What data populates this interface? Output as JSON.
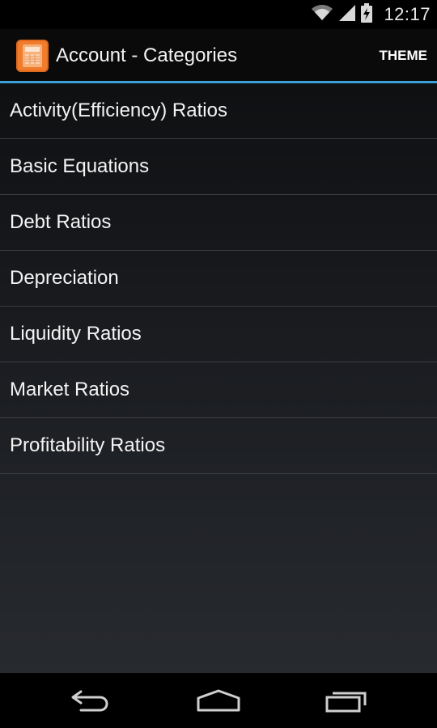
{
  "status_bar": {
    "time": "12:17",
    "icons": [
      "wifi-icon",
      "signal-icon",
      "battery-charging-icon"
    ]
  },
  "action_bar": {
    "title": "Account - Categories",
    "theme_label": "THEME",
    "app_icon": "calculator-icon",
    "accent_color": "#3aa0d8"
  },
  "categories": [
    {
      "label": "Activity(Efficiency) Ratios"
    },
    {
      "label": "Basic Equations"
    },
    {
      "label": "Debt Ratios"
    },
    {
      "label": "Depreciation"
    },
    {
      "label": "Liquidity Ratios"
    },
    {
      "label": "Market Ratios"
    },
    {
      "label": "Profitability Ratios"
    }
  ],
  "nav_bar": {
    "icons": [
      "back-icon",
      "home-icon",
      "recent-apps-icon"
    ]
  }
}
